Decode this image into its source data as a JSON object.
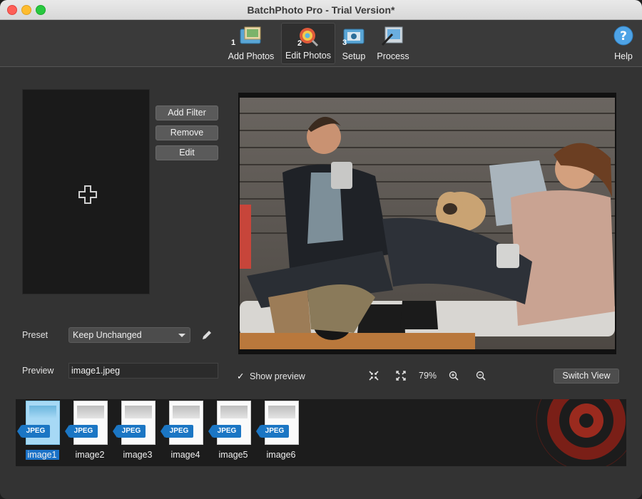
{
  "window": {
    "title": "BatchPhoto Pro - Trial Version*"
  },
  "toolbar": {
    "items": [
      {
        "label": "Add Photos",
        "number": "1",
        "icon": "add-photos-icon"
      },
      {
        "label": "Edit Photos",
        "number": "2",
        "icon": "edit-photos-icon",
        "active": true
      },
      {
        "label": "Setup",
        "number": "3",
        "icon": "setup-icon"
      },
      {
        "label": "Process",
        "number": "",
        "icon": "process-icon"
      }
    ],
    "help_label": "Help"
  },
  "filters": {
    "add_filter_label": "Add Filter",
    "remove_label": "Remove",
    "edit_label": "Edit"
  },
  "preset": {
    "label": "Preset",
    "value": "Keep Unchanged"
  },
  "preview": {
    "label": "Preview",
    "value": "image1.jpeg"
  },
  "controls": {
    "show_preview_label": "Show preview",
    "show_preview_checked": true,
    "zoom": "79%",
    "switch_view_label": "Switch View"
  },
  "filmstrip": {
    "items": [
      {
        "name": "image1",
        "badge": "JPEG",
        "selected": true
      },
      {
        "name": "image2",
        "badge": "JPEG"
      },
      {
        "name": "image3",
        "badge": "JPEG"
      },
      {
        "name": "image4",
        "badge": "JPEG"
      },
      {
        "name": "image5",
        "badge": "JPEG"
      },
      {
        "name": "image6",
        "badge": "JPEG"
      }
    ]
  },
  "colors": {
    "accent": "#1b72c8",
    "badge": "#1b76c4",
    "background": "#333333"
  }
}
